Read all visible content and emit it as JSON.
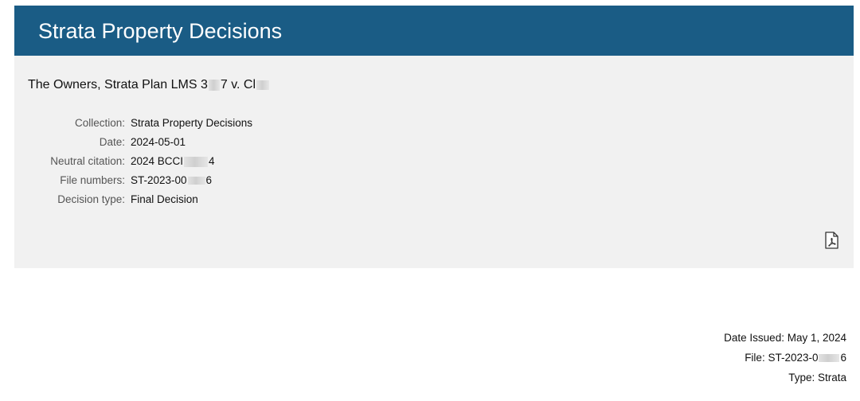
{
  "banner": {
    "title": "Strata Property Decisions"
  },
  "case": {
    "title_prefix": "The Owners, Strata Plan LMS 3",
    "title_mid": "7 v. Cl"
  },
  "meta": {
    "collection_label": "Collection:",
    "collection_value": "Strata Property Decisions",
    "date_label": "Date:",
    "date_value": "2024-05-01",
    "citation_label": "Neutral citation:",
    "citation_prefix": "2024 BCCI",
    "citation_suffix": "4",
    "file_label": "File numbers:",
    "file_prefix": "ST-2023-00",
    "file_suffix": "6",
    "decision_label": "Decision type:",
    "decision_value": "Final Decision"
  },
  "icons": {
    "pdf": "pdf-document-icon"
  },
  "footer": {
    "date_issued": "Date Issued: May 1, 2024",
    "file_prefix": "File: ST-2023-0",
    "file_suffix": "6",
    "type": "Type: Strata"
  }
}
